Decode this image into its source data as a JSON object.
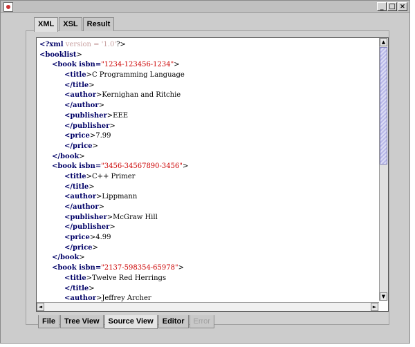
{
  "window": {
    "minimize_glyph": "_",
    "maximize_glyph": "□",
    "close_glyph": "×"
  },
  "top_tabs": [
    {
      "label": "XML",
      "active": true
    },
    {
      "label": "XSL",
      "active": false
    },
    {
      "label": "Result",
      "active": false
    }
  ],
  "bottom_tabs": [
    {
      "label": "File",
      "active": false,
      "enabled": true
    },
    {
      "label": "Tree View",
      "active": false,
      "enabled": true
    },
    {
      "label": "Source View",
      "active": true,
      "enabled": true
    },
    {
      "label": "Editor",
      "active": false,
      "enabled": true
    },
    {
      "label": "Error",
      "active": false,
      "enabled": false
    }
  ],
  "scrollbar": {
    "up_arrow": "▲",
    "down_arrow": "▼",
    "left_arrow": "◄",
    "right_arrow": "►"
  },
  "source_lines": [
    {
      "indent": 0,
      "parts": [
        {
          "t": "<?xml",
          "c": "tag"
        },
        {
          "t": " version = '1.0'",
          "c": "decl"
        },
        {
          "t": "?>",
          "c": "plain"
        }
      ]
    },
    {
      "indent": 0,
      "parts": [
        {
          "t": "<booklist",
          "c": "tag"
        },
        {
          "t": ">",
          "c": "plain"
        }
      ]
    },
    {
      "indent": 1,
      "parts": [
        {
          "t": "<book isbn=",
          "c": "tag"
        },
        {
          "t": "\"1234-123456-1234\"",
          "c": "attrval"
        },
        {
          "t": ">",
          "c": "plain"
        }
      ]
    },
    {
      "indent": 2,
      "parts": [
        {
          "t": "<title",
          "c": "tag"
        },
        {
          "t": ">C Programming Language",
          "c": "plain"
        }
      ]
    },
    {
      "indent": 2,
      "parts": [
        {
          "t": "</title",
          "c": "tag"
        },
        {
          "t": ">",
          "c": "plain"
        }
      ]
    },
    {
      "indent": 2,
      "parts": [
        {
          "t": "<author",
          "c": "tag"
        },
        {
          "t": ">Kernighan and Ritchie",
          "c": "plain"
        }
      ]
    },
    {
      "indent": 2,
      "parts": [
        {
          "t": "</author",
          "c": "tag"
        },
        {
          "t": ">",
          "c": "plain"
        }
      ]
    },
    {
      "indent": 2,
      "parts": [
        {
          "t": "<publisher",
          "c": "tag"
        },
        {
          "t": ">EEE",
          "c": "plain"
        }
      ]
    },
    {
      "indent": 2,
      "parts": [
        {
          "t": "</publisher",
          "c": "tag"
        },
        {
          "t": ">",
          "c": "plain"
        }
      ]
    },
    {
      "indent": 2,
      "parts": [
        {
          "t": "<price",
          "c": "tag"
        },
        {
          "t": ">7.99",
          "c": "plain"
        }
      ]
    },
    {
      "indent": 2,
      "parts": [
        {
          "t": "</price",
          "c": "tag"
        },
        {
          "t": ">",
          "c": "plain"
        }
      ]
    },
    {
      "indent": 1,
      "parts": [
        {
          "t": "</book",
          "c": "tag"
        },
        {
          "t": ">",
          "c": "plain"
        }
      ]
    },
    {
      "indent": 1,
      "parts": [
        {
          "t": "<book isbn=",
          "c": "tag"
        },
        {
          "t": "\"3456-34567890-3456\"",
          "c": "attrval"
        },
        {
          "t": ">",
          "c": "plain"
        }
      ]
    },
    {
      "indent": 2,
      "parts": [
        {
          "t": "<title",
          "c": "tag"
        },
        {
          "t": ">C++ Primer",
          "c": "plain"
        }
      ]
    },
    {
      "indent": 2,
      "parts": [
        {
          "t": "</title",
          "c": "tag"
        },
        {
          "t": ">",
          "c": "plain"
        }
      ]
    },
    {
      "indent": 2,
      "parts": [
        {
          "t": "<author",
          "c": "tag"
        },
        {
          "t": ">Lippmann",
          "c": "plain"
        }
      ]
    },
    {
      "indent": 2,
      "parts": [
        {
          "t": "</author",
          "c": "tag"
        },
        {
          "t": ">",
          "c": "plain"
        }
      ]
    },
    {
      "indent": 2,
      "parts": [
        {
          "t": "<publisher",
          "c": "tag"
        },
        {
          "t": ">McGraw Hill",
          "c": "plain"
        }
      ]
    },
    {
      "indent": 2,
      "parts": [
        {
          "t": "</publisher",
          "c": "tag"
        },
        {
          "t": ">",
          "c": "plain"
        }
      ]
    },
    {
      "indent": 2,
      "parts": [
        {
          "t": "<price",
          "c": "tag"
        },
        {
          "t": ">4.99",
          "c": "plain"
        }
      ]
    },
    {
      "indent": 2,
      "parts": [
        {
          "t": "</price",
          "c": "tag"
        },
        {
          "t": ">",
          "c": "plain"
        }
      ]
    },
    {
      "indent": 1,
      "parts": [
        {
          "t": "</book",
          "c": "tag"
        },
        {
          "t": ">",
          "c": "plain"
        }
      ]
    },
    {
      "indent": 1,
      "parts": [
        {
          "t": "<book isbn=",
          "c": "tag"
        },
        {
          "t": "\"2137-598354-65978\"",
          "c": "attrval"
        },
        {
          "t": ">",
          "c": "plain"
        }
      ]
    },
    {
      "indent": 2,
      "parts": [
        {
          "t": "<title",
          "c": "tag"
        },
        {
          "t": ">Twelve Red Herrings",
          "c": "plain"
        }
      ]
    },
    {
      "indent": 2,
      "parts": [
        {
          "t": "</title",
          "c": "tag"
        },
        {
          "t": ">",
          "c": "plain"
        }
      ]
    },
    {
      "indent": 2,
      "parts": [
        {
          "t": "<author",
          "c": "tag"
        },
        {
          "t": ">Jeffrey Archer",
          "c": "plain"
        }
      ]
    }
  ],
  "colors": {
    "tag": "#000066",
    "attribute_value": "#cc0000",
    "declaration": "#c8a0a0",
    "scroll_thumb": "#b8b8e8"
  }
}
